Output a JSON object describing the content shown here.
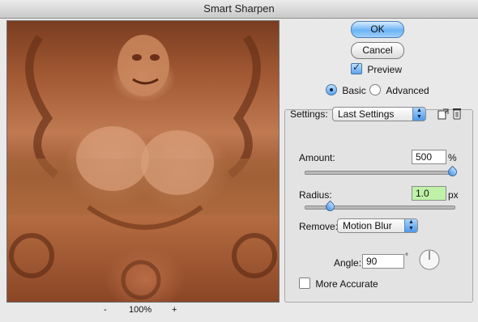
{
  "window": {
    "title": "Smart Sharpen"
  },
  "preview": {
    "zoom_minus": "-",
    "zoom_value": "100%",
    "zoom_plus": "+"
  },
  "buttons": {
    "ok": "OK",
    "cancel": "Cancel"
  },
  "preview_option": {
    "label": "Preview",
    "checked": true
  },
  "mode": {
    "basic": "Basic",
    "advanced": "Advanced",
    "selected": "Basic"
  },
  "settings": {
    "label": "Settings:",
    "value": "Last Settings",
    "save_icon": "save-settings-icon",
    "delete_icon": "trash-icon"
  },
  "amount": {
    "label": "Amount:",
    "value": "500",
    "unit": "%",
    "level": 1.0
  },
  "radius": {
    "label": "Radius:",
    "value": "1.0",
    "unit": "px",
    "level": 0.1
  },
  "remove": {
    "label": "Remove:",
    "value": "Motion Blur"
  },
  "angle": {
    "label": "Angle:",
    "value": "90",
    "unit": "°"
  },
  "more_accurate": {
    "label": "More Accurate",
    "checked": false
  },
  "colors": {
    "default_button": "#6cb3f5",
    "radius_highlight": "#bff2a8"
  }
}
